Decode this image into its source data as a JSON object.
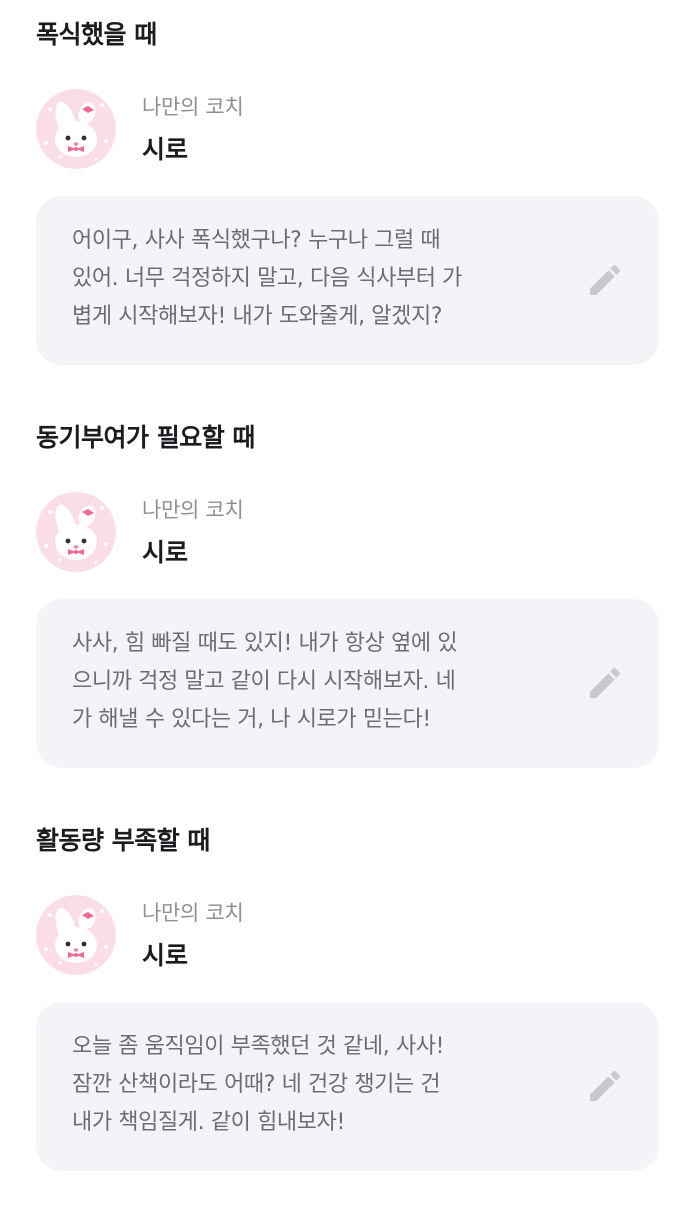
{
  "sections": [
    {
      "title": "폭식했을 때",
      "coach_label": "나만의 코치",
      "coach_name": "시로",
      "message": "어이구, 사사 폭식했구나? 누구나 그럴 때\n있어. 너무 걱정하지 말고, 다음 식사부터 가\n볍게 시작해보자! 내가 도와줄게, 알겠지?",
      "edit_icon": "pencil-icon"
    },
    {
      "title": "동기부여가 필요할 때",
      "coach_label": "나만의 코치",
      "coach_name": "시로",
      "message": "사사, 힘 빠질 때도 있지! 내가 항상 옆에 있\n으니까 걱정 말고 같이 다시 시작해보자. 네\n가 해낼 수 있다는 거, 나 시로가 믿는다!",
      "edit_icon": "pencil-icon"
    },
    {
      "title": "활동량 부족할 때",
      "coach_label": "나만의 코치",
      "coach_name": "시로",
      "message": "오늘 좀 움직임이 부족했던 것 같네, 사사!\n잠깐 산책이라도 어때? 네 건강 챙기는 건\n내가 책임질게. 같이 힘내보자!",
      "edit_icon": "pencil-icon"
    }
  ],
  "colors": {
    "bubble_bg": "#f3f4f8",
    "message_text": "#6c6c73",
    "label_text": "#8f8f96",
    "icon": "#c8c8cf",
    "avatar_bg": "#fbdde8"
  }
}
